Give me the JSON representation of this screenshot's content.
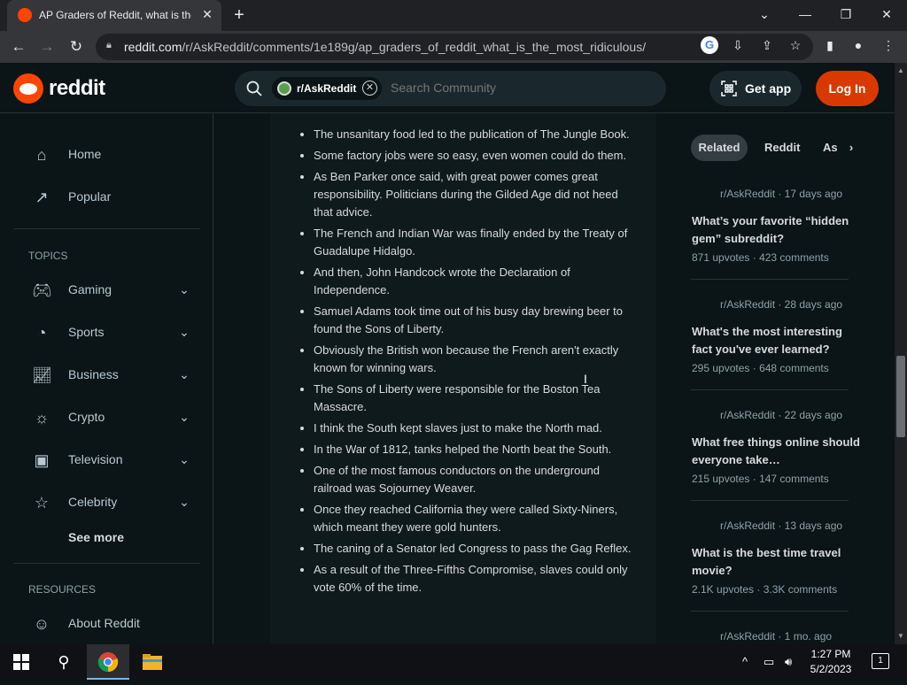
{
  "browser": {
    "tab_title": "AP Graders of Reddit, what is the",
    "tab_close": "✕",
    "new_tab": "+",
    "url_domain": "reddit.com",
    "url_path": "/r/AskReddit/comments/1e189g/ap_graders_of_reddit_what_is_the_most_ridiculous/",
    "window_controls": [
      "⌄",
      "—",
      "❐",
      "✕"
    ]
  },
  "reddit_header": {
    "wordmark": "reddit",
    "search": {
      "community_chip": "r/AskReddit",
      "placeholder": "Search Community"
    },
    "get_app": "Get app",
    "login": "Log In"
  },
  "leftnav": {
    "main": [
      {
        "label": "Home",
        "icon": "home-icon"
      },
      {
        "label": "Popular",
        "icon": "popular-icon"
      }
    ],
    "topics_heading": "TOPICS",
    "topics": [
      {
        "label": "Gaming",
        "icon": "gamepad-icon"
      },
      {
        "label": "Sports",
        "icon": "sports-icon"
      },
      {
        "label": "Business",
        "icon": "business-icon"
      },
      {
        "label": "Crypto",
        "icon": "crypto-icon"
      },
      {
        "label": "Television",
        "icon": "television-icon"
      },
      {
        "label": "Celebrity",
        "icon": "celebrity-icon"
      }
    ],
    "see_more": "See more",
    "resources_heading": "RESOURCES",
    "resources": [
      {
        "label": "About Reddit",
        "icon": "about-icon"
      }
    ]
  },
  "post": {
    "items": [
      "The unsanitary food led to the publication of The Jungle Book.",
      "Some factory jobs were so easy, even women could do them.",
      "As Ben Parker once said, with great power comes great responsibility. Politicians during the Gilded Age did not heed that advice.",
      "The French and Indian War was finally ended by the Treaty of Guadalupe Hidalgo.",
      "And then, John Handcock wrote the Declaration of Independence.",
      "Samuel Adams took time out of his busy day brewing beer to found the Sons of Liberty.",
      "Obviously the British won because the French aren't exactly known for winning wars.",
      "The Sons of Liberty were responsible for the Boston Tea Massacre.",
      "I think the South kept slaves just to make the North mad.",
      "In the War of 1812, tanks helped the North beat the South.",
      "One of the most famous conductors on the underground railroad was Sojourney Weaver.",
      "Once they reached California they were called Sixty-Niners, which meant they were gold hunters.",
      "The caning of a Senator led Congress to pass the Gag Reflex.",
      "As a result of the Three-Fifths Compromise, slaves could only vote 60% of the time."
    ]
  },
  "right": {
    "tabs": [
      "Related",
      "Reddit",
      "As"
    ],
    "related": [
      {
        "meta": "r/AskReddit · 17 days ago",
        "title": "What’s your favorite “hidden gem” subreddit?",
        "upvotes": "871 upvotes",
        "comments": "423 comments"
      },
      {
        "meta": "r/AskReddit · 28 days ago",
        "title": "What's the most interesting fact you've ever learned?",
        "upvotes": "295 upvotes",
        "comments": "648 comments"
      },
      {
        "meta": "r/AskReddit · 22 days ago",
        "title": "What free things online should everyone take…",
        "upvotes": "215 upvotes",
        "comments": "147 comments"
      },
      {
        "meta": "r/AskReddit · 13 days ago",
        "title": "What is the best time travel movie?",
        "upvotes": "2.1K upvotes",
        "comments": "3.3K comments"
      },
      {
        "meta": "r/AskReddit · 1 mo. ago",
        "title": "",
        "upvotes": "",
        "comments": ""
      }
    ]
  },
  "taskbar": {
    "time": "1:27 PM",
    "date": "5/2/2023",
    "notifications": "1"
  },
  "colors": {
    "reddit_orange": "#ff4500",
    "login_button": "#d93900",
    "background": "#0b1416"
  }
}
